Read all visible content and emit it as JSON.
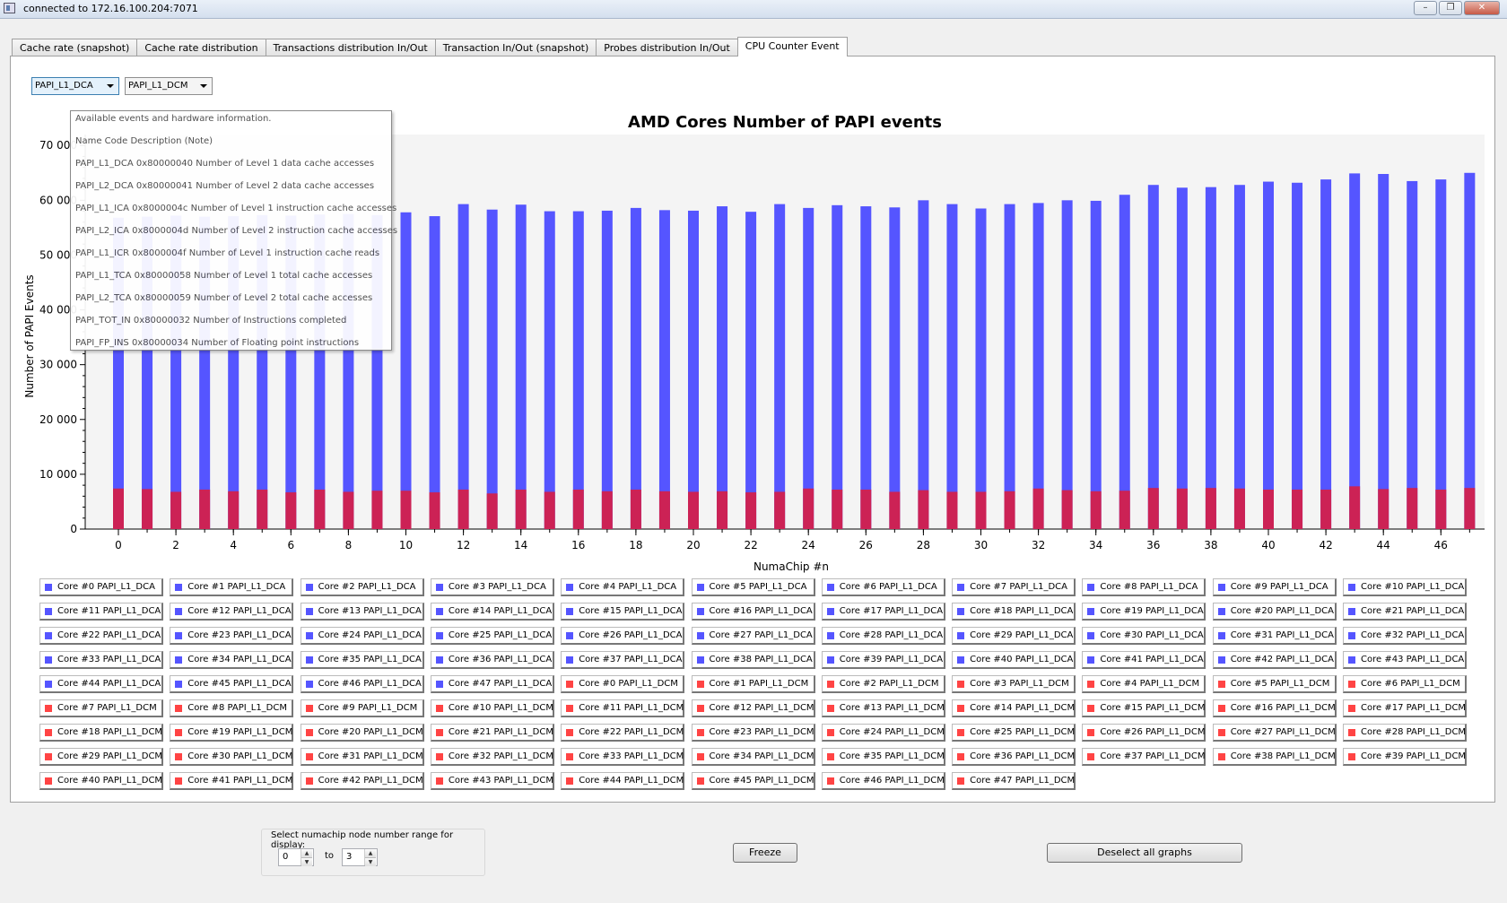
{
  "window": {
    "title": "connected to 172.16.100.204:7071",
    "min_symbol": "–",
    "max_symbol": "❐",
    "close_symbol": "✕"
  },
  "tabs": [
    {
      "label": "Cache rate (snapshot)"
    },
    {
      "label": "Cache rate distribution"
    },
    {
      "label": "Transactions distribution In/Out"
    },
    {
      "label": "Transaction In/Out (snapshot)"
    },
    {
      "label": "Probes distribution In/Out"
    },
    {
      "label": "CPU Counter Event",
      "active": true
    }
  ],
  "event_selectors": [
    {
      "selected": "PAPI_L1_DCA"
    },
    {
      "selected": "PAPI_L1_DCM"
    }
  ],
  "event_popup": {
    "lines": [
      "Available events and hardware information.",
      "Name Code Description (Note)",
      "PAPI_L1_DCA 0x80000040 Number of Level 1 data cache accesses",
      "PAPI_L2_DCA 0x80000041 Number of Level 2 data cache accesses",
      "PAPI_L1_ICA 0x8000004c Number of Level 1 instruction cache accesses",
      "PAPI_L2_ICA 0x8000004d Number of Level 2 instruction cache accesses",
      "PAPI_L1_ICR 0x8000004f Number of Level 1 instruction cache reads",
      "PAPI_L1_TCA 0x80000058 Number of Level 1 total cache accesses",
      "PAPI_L2_TCA 0x80000059 Number of Level 2 total cache accesses",
      "PAPI_TOT_IN 0x80000032 Number of Instructions completed",
      "PAPI_FP_INS 0x80000034 Number of Floating point instructions"
    ]
  },
  "chart_data": {
    "type": "bar",
    "title": "AMD Cores Number of PAPI events",
    "xlabel": "NumaChip #n",
    "ylabel": "Number of PAPI Events",
    "ylim": [
      0,
      72000
    ],
    "yticks": [
      0,
      10000,
      20000,
      30000,
      40000,
      50000,
      60000,
      70000
    ],
    "ytick_labels": [
      "0",
      "10 000",
      "20 000",
      "30 000",
      "40 000",
      "50 000",
      "60 000",
      "70 000"
    ],
    "xticks": [
      0,
      2,
      4,
      6,
      8,
      10,
      12,
      14,
      16,
      18,
      20,
      22,
      24,
      26,
      28,
      30,
      32,
      34,
      36,
      38,
      40,
      42,
      44,
      46
    ],
    "x": [
      0,
      1,
      2,
      3,
      4,
      5,
      6,
      7,
      8,
      9,
      10,
      11,
      12,
      13,
      14,
      15,
      16,
      17,
      18,
      19,
      20,
      21,
      22,
      23,
      24,
      25,
      26,
      27,
      28,
      29,
      30,
      31,
      32,
      33,
      34,
      35,
      36,
      37,
      38,
      39,
      40,
      41,
      42,
      43,
      44,
      45,
      46,
      47
    ],
    "grid": false,
    "series": [
      {
        "name": "PAPI_L1_DCA",
        "color": "#5555ff",
        "values": [
          56800,
          57000,
          57200,
          57000,
          57100,
          57300,
          57200,
          57400,
          57500,
          57300,
          57800,
          57100,
          59300,
          58300,
          59200,
          58000,
          58000,
          58100,
          58600,
          58200,
          58100,
          58900,
          57900,
          59300,
          58600,
          59100,
          58900,
          58700,
          60000,
          59300,
          58500,
          59300,
          59500,
          60000,
          59900,
          61000,
          62800,
          62300,
          62400,
          62800,
          63400,
          63200,
          63800,
          64900,
          64800,
          63500,
          63800,
          65000
        ]
      },
      {
        "name": "PAPI_L1_DCM",
        "color": "#cc2255",
        "values": [
          7400,
          7300,
          6800,
          7200,
          6900,
          7200,
          6700,
          7200,
          6800,
          7000,
          7000,
          6700,
          7200,
          6500,
          7200,
          6800,
          7200,
          6900,
          7200,
          6900,
          6800,
          6900,
          6700,
          6800,
          7400,
          7200,
          7200,
          6800,
          7100,
          6800,
          6800,
          6900,
          7400,
          7100,
          6900,
          7000,
          7500,
          7400,
          7500,
          7400,
          7200,
          7200,
          7200,
          7800,
          7300,
          7500,
          7200,
          7500
        ]
      }
    ]
  },
  "legend": {
    "dca_color": "#5555ff",
    "dcm_color": "#ff4444",
    "entries": [
      "Core #0 PAPI_L1_DCA",
      "Core #1 PAPI_L1_DCA",
      "Core #2 PAPI_L1_DCA",
      "Core #3 PAPI_L1_DCA",
      "Core #4 PAPI_L1_DCA",
      "Core #5 PAPI_L1_DCA",
      "Core #6 PAPI_L1_DCA",
      "Core #7 PAPI_L1_DCA",
      "Core #8 PAPI_L1_DCA",
      "Core #9 PAPI_L1_DCA",
      "Core #10 PAPI_L1_DCA",
      "Core #11 PAPI_L1_DCA",
      "Core #12 PAPI_L1_DCA",
      "Core #13 PAPI_L1_DCA",
      "Core #14 PAPI_L1_DCA",
      "Core #15 PAPI_L1_DCA",
      "Core #16 PAPI_L1_DCA",
      "Core #17 PAPI_L1_DCA",
      "Core #18 PAPI_L1_DCA",
      "Core #19 PAPI_L1_DCA",
      "Core #20 PAPI_L1_DCA",
      "Core #21 PAPI_L1_DCA",
      "Core #22 PAPI_L1_DCA",
      "Core #23 PAPI_L1_DCA",
      "Core #24 PAPI_L1_DCA",
      "Core #25 PAPI_L1_DCA",
      "Core #26 PAPI_L1_DCA",
      "Core #27 PAPI_L1_DCA",
      "Core #28 PAPI_L1_DCA",
      "Core #29 PAPI_L1_DCA",
      "Core #30 PAPI_L1_DCA",
      "Core #31 PAPI_L1_DCA",
      "Core #32 PAPI_L1_DCA",
      "Core #33 PAPI_L1_DCA",
      "Core #34 PAPI_L1_DCA",
      "Core #35 PAPI_L1_DCA",
      "Core #36 PAPI_L1_DCA",
      "Core #37 PAPI_L1_DCA",
      "Core #38 PAPI_L1_DCA",
      "Core #39 PAPI_L1_DCA",
      "Core #40 PAPI_L1_DCA",
      "Core #41 PAPI_L1_DCA",
      "Core #42 PAPI_L1_DCA",
      "Core #43 PAPI_L1_DCA",
      "Core #44 PAPI_L1_DCA",
      "Core #45 PAPI_L1_DCA",
      "Core #46 PAPI_L1_DCA",
      "Core #47 PAPI_L1_DCA",
      "Core #0 PAPI_L1_DCM",
      "Core #1 PAPI_L1_DCM",
      "Core #2 PAPI_L1_DCM",
      "Core #3 PAPI_L1_DCM",
      "Core #4 PAPI_L1_DCM",
      "Core #5 PAPI_L1_DCM",
      "Core #6 PAPI_L1_DCM",
      "Core #7 PAPI_L1_DCM",
      "Core #8 PAPI_L1_DCM",
      "Core #9 PAPI_L1_DCM",
      "Core #10 PAPI_L1_DCM",
      "Core #11 PAPI_L1_DCM",
      "Core #12 PAPI_L1_DCM",
      "Core #13 PAPI_L1_DCM",
      "Core #14 PAPI_L1_DCM",
      "Core #15 PAPI_L1_DCM",
      "Core #16 PAPI_L1_DCM",
      "Core #17 PAPI_L1_DCM",
      "Core #18 PAPI_L1_DCM",
      "Core #19 PAPI_L1_DCM",
      "Core #20 PAPI_L1_DCM",
      "Core #21 PAPI_L1_DCM",
      "Core #22 PAPI_L1_DCM",
      "Core #23 PAPI_L1_DCM",
      "Core #24 PAPI_L1_DCM",
      "Core #25 PAPI_L1_DCM",
      "Core #26 PAPI_L1_DCM",
      "Core #27 PAPI_L1_DCM",
      "Core #28 PAPI_L1_DCM",
      "Core #29 PAPI_L1_DCM",
      "Core #30 PAPI_L1_DCM",
      "Core #31 PAPI_L1_DCM",
      "Core #32 PAPI_L1_DCM",
      "Core #33 PAPI_L1_DCM",
      "Core #34 PAPI_L1_DCM",
      "Core #35 PAPI_L1_DCM",
      "Core #36 PAPI_L1_DCM",
      "Core #37 PAPI_L1_DCM",
      "Core #38 PAPI_L1_DCM",
      "Core #39 PAPI_L1_DCM",
      "Core #40 PAPI_L1_DCM",
      "Core #41 PAPI_L1_DCM",
      "Core #42 PAPI_L1_DCM",
      "Core #43 PAPI_L1_DCM",
      "Core #44 PAPI_L1_DCM",
      "Core #45 PAPI_L1_DCM",
      "Core #46 PAPI_L1_DCM",
      "Core #47 PAPI_L1_DCM"
    ]
  },
  "range_selector": {
    "caption": "Select numachip node number range for display:",
    "from": "0",
    "to_label": "to",
    "to": "3",
    "up_icon": "▲",
    "down_icon": "▼"
  },
  "buttons": {
    "freeze": "Freeze",
    "deselect_all": "Deselect all graphs"
  }
}
